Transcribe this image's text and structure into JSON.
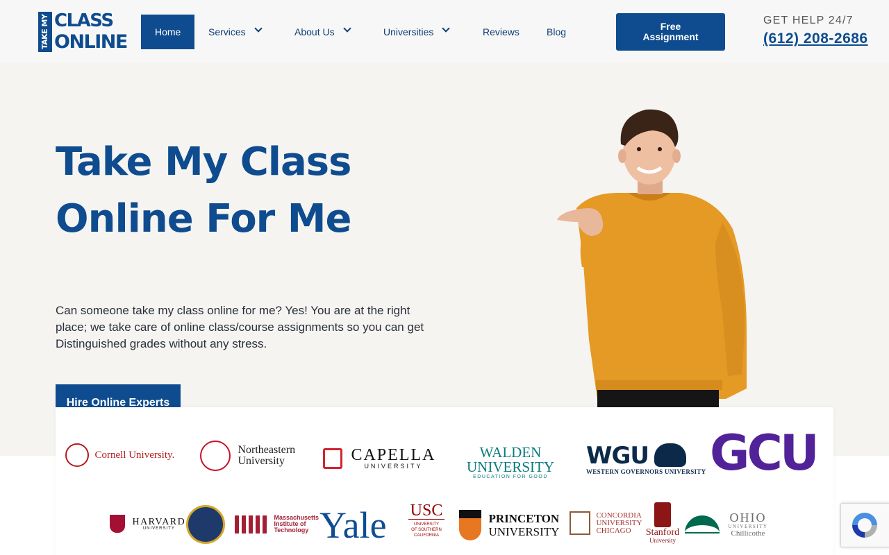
{
  "logo": {
    "top_text": "CLASS",
    "bottom_text": "ONLINE",
    "side_text": "TAKE MY"
  },
  "nav": {
    "home": "Home",
    "services": "Services",
    "about": "About Us",
    "universities": "Universities",
    "reviews": "Reviews",
    "blog": "Blog"
  },
  "header": {
    "free_assignment_line1": "Free",
    "free_assignment_line2": "Assignment",
    "help_label": "GET HELP 24/7",
    "phone": "(612) 208-2686"
  },
  "hero": {
    "title_line1": "Take My Class",
    "title_line2": "Online For Me",
    "description": "Can someone take my class online for me? Yes! You are at the right place; we take care of online class/course assignments so you can get Distinguished grades without any stress.",
    "cta": "Hire Online Experts"
  },
  "universities": {
    "cornell": "Cornell University.",
    "northeastern_1": "Northeastern",
    "northeastern_2": "University",
    "capella": "CAPELLA",
    "capella_sub": "UNIVERSITY",
    "walden_1": "WALDEN",
    "walden_2": "UNIVERSITY",
    "walden_sub": "EDUCATION FOR GOOD",
    "wgu": "WGU",
    "wgu_sub": "WESTERN GOVERNORS UNIVERSITY",
    "gcu": "GCU",
    "harvard": "HARVARD",
    "harvard_sub": "UNIVERSITY",
    "mit_1": "Massachusetts",
    "mit_2": "Institute of",
    "mit_3": "Technology",
    "yale": "Yale",
    "usc": "USC",
    "usc_sub1": "UNIVERSITY",
    "usc_sub2": "OF SOUTHERN",
    "usc_sub3": "CALIFORNIA",
    "princeton_1": "PRINCETON",
    "princeton_2": "UNIVERSITY",
    "concordia_1": "CONCORDIA",
    "concordia_2": "UNIVERSITY",
    "concordia_3": "CHICAGO",
    "stanford": "Stanford",
    "stanford_sub": "University",
    "ohio_1": "OHIO",
    "ohio_2": "UNIVERSITY",
    "ohio_3": "Chillicothe"
  },
  "colors": {
    "brand": "#0e4c8f",
    "gcu_purple": "#522398",
    "cornell_red": "#b31b1b",
    "walden_teal": "#0a7b7f",
    "person_sweater": "#e49a24"
  }
}
